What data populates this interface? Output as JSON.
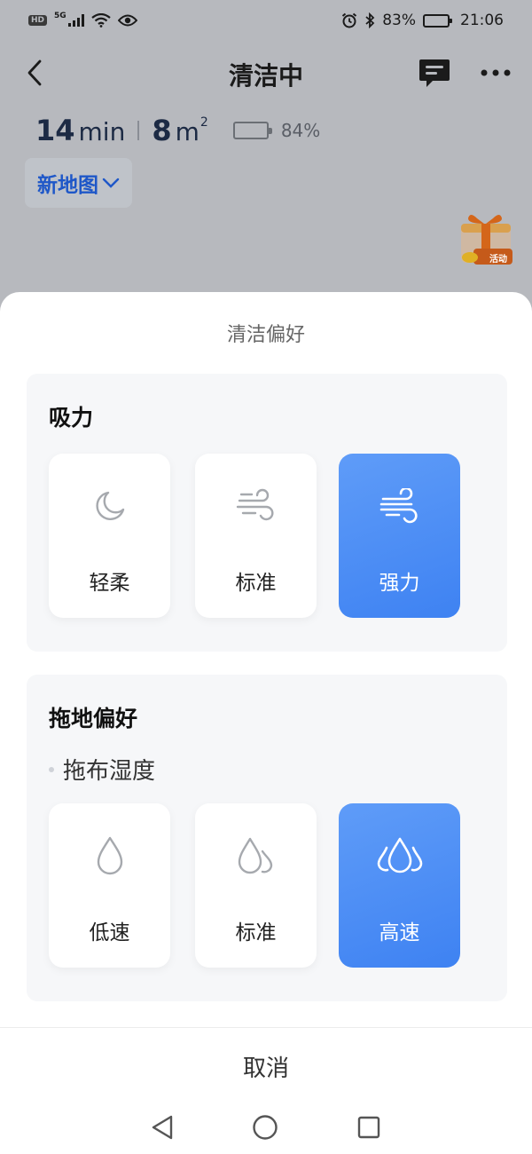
{
  "status_bar": {
    "hd": "HD",
    "network": "5G",
    "battery_text": "83%",
    "battery_level": 0.83,
    "time": "21:06"
  },
  "header": {
    "title": "清洁中"
  },
  "stats": {
    "duration_value": "14",
    "duration_unit": "min",
    "area_value": "8",
    "area_unit": "m",
    "area_unit_sup": "2",
    "battery_text": "84%",
    "battery_level": 0.84
  },
  "map_selector": {
    "label": "新地图"
  },
  "promo": {
    "badge": "活动"
  },
  "sheet": {
    "title": "清洁偏好",
    "suction": {
      "title": "吸力",
      "options": [
        {
          "label": "轻柔",
          "icon": "moon-icon",
          "selected": false
        },
        {
          "label": "标准",
          "icon": "wind-icon",
          "selected": false
        },
        {
          "label": "强力",
          "icon": "strong-wind-icon",
          "selected": true
        }
      ]
    },
    "mop": {
      "title": "拖地偏好",
      "subtitle": "拖布湿度",
      "options": [
        {
          "label": "低速",
          "icon": "single-drop-icon",
          "selected": false
        },
        {
          "label": "标准",
          "icon": "double-drop-icon",
          "selected": false
        },
        {
          "label": "高速",
          "icon": "triple-drop-icon",
          "selected": true
        }
      ]
    },
    "cancel_label": "取消"
  },
  "colors": {
    "accent": "#4b8df5",
    "map_link": "#1e57c8",
    "battery_green": "#1f8a2c"
  }
}
